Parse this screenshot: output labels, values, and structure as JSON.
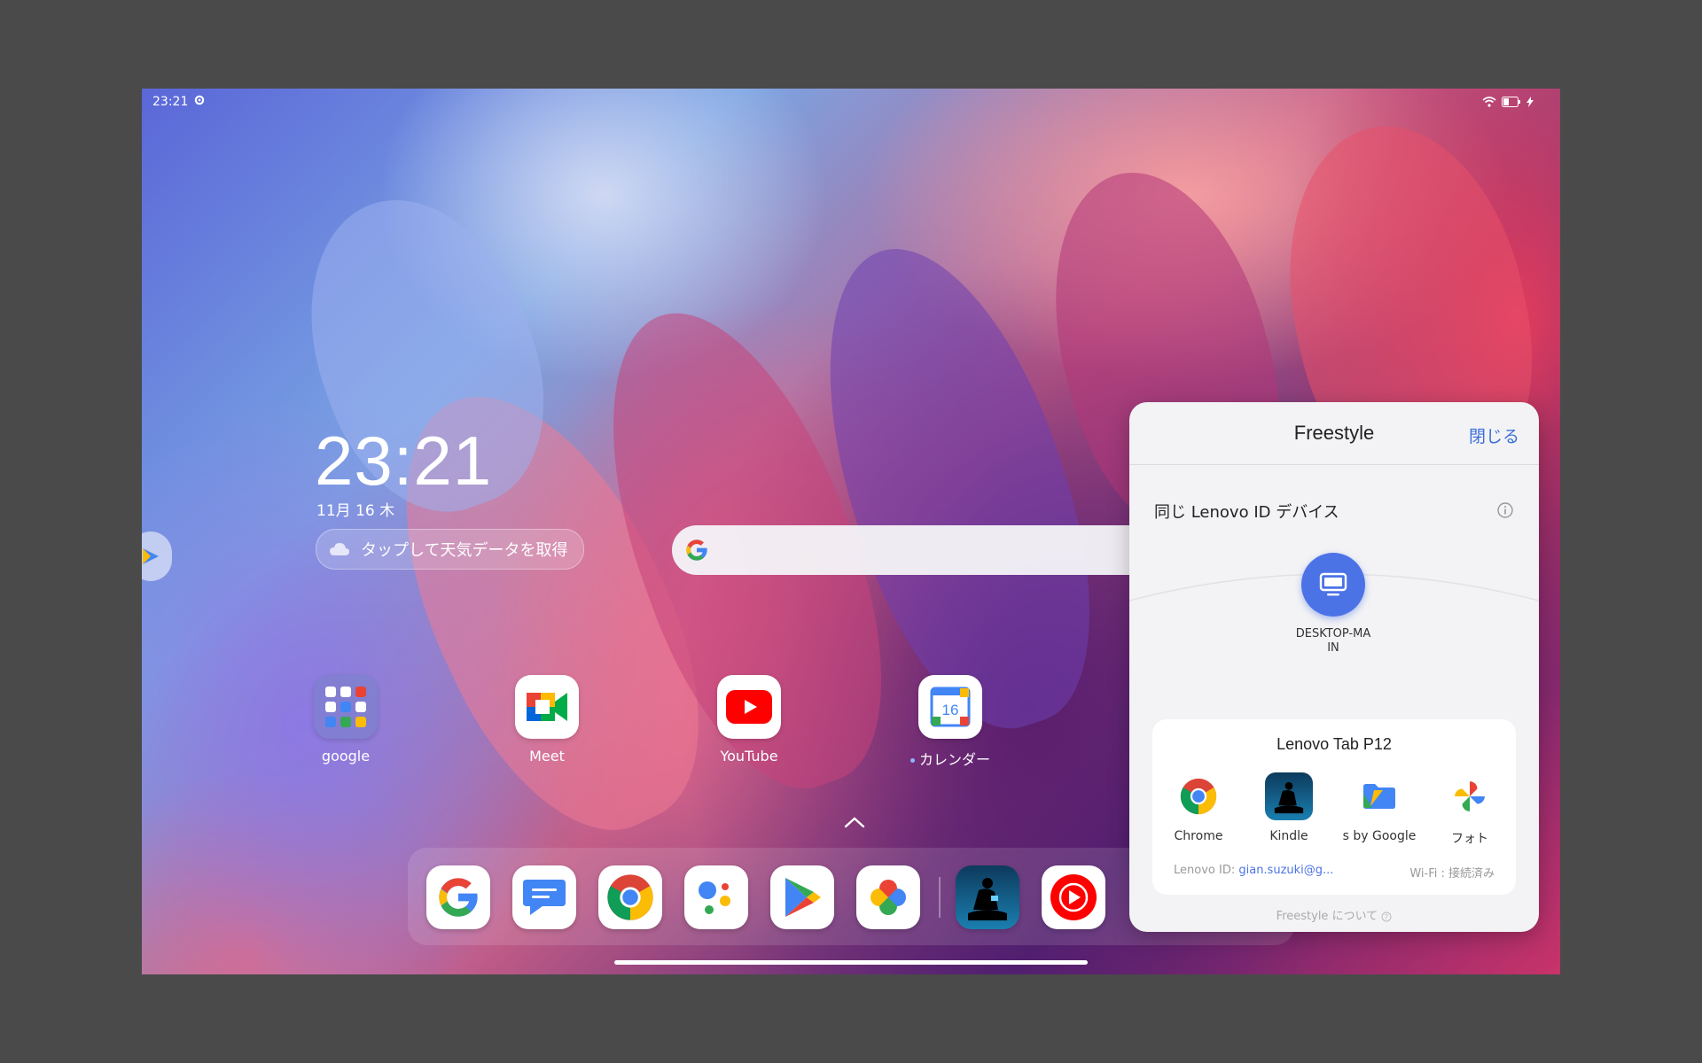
{
  "status_bar": {
    "time": "23:21"
  },
  "clock_widget": {
    "time": "23:21",
    "date": "11月 16 木"
  },
  "weather": {
    "label": "タップして天気データを取得"
  },
  "home_apps": [
    {
      "label": "google"
    },
    {
      "label": "Meet"
    },
    {
      "label": "YouTube"
    },
    {
      "label": "カレンダー"
    }
  ],
  "calendar_day": "16",
  "freestyle": {
    "title": "Freestyle",
    "close_label": "閉じる",
    "section_label": "同じ Lenovo ID デバイス",
    "device_name_line1": "DESKTOP-MA",
    "device_name_line2": "IN",
    "card_title": "Lenovo Tab P12",
    "card_apps": [
      {
        "label": "Chrome"
      },
      {
        "label": "Kindle"
      },
      {
        "label": "s by Google"
      },
      {
        "label": "フォト"
      }
    ],
    "lenovo_id_prefix": "Lenovo ID:",
    "lenovo_id_value": "gian.suzuki@g...",
    "wifi_status": "Wi-Fi : 接続済み",
    "about_label": "Freestyle について"
  }
}
